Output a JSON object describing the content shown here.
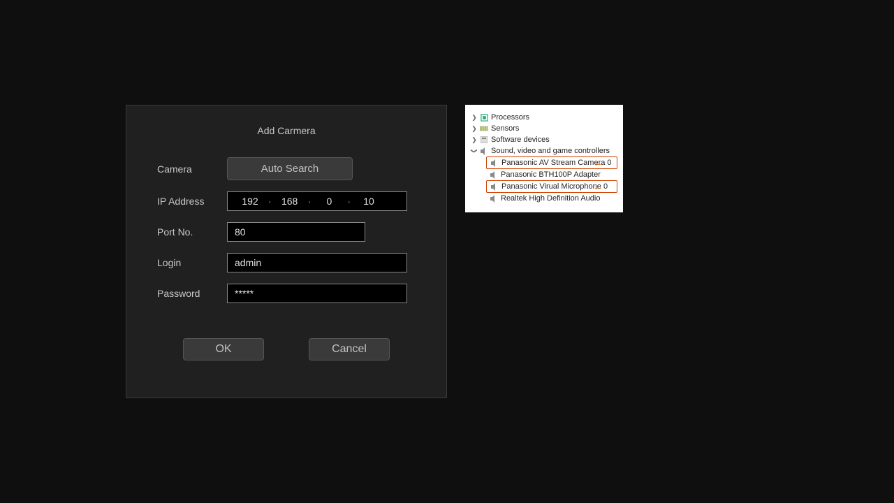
{
  "dialog": {
    "title": "Add Carmera",
    "labels": {
      "camera": "Camera",
      "ip": "IP  Address",
      "port": "Port No.",
      "login": "Login",
      "password": "Password"
    },
    "auto_search": "Auto Search",
    "ip_octets": [
      "192",
      "168",
      "0",
      "10"
    ],
    "port_value": "80",
    "login_value": "admin",
    "password_value": "*****",
    "ok": "OK",
    "cancel": "Cancel"
  },
  "device_tree": {
    "items": [
      {
        "label": "Processors",
        "expanded": false,
        "level": 0
      },
      {
        "label": "Sensors",
        "expanded": false,
        "level": 0
      },
      {
        "label": "Software devices",
        "expanded": false,
        "level": 0
      },
      {
        "label": "Sound, video and game controllers",
        "expanded": true,
        "level": 0
      }
    ],
    "children": [
      {
        "label": "Panasonic AV Stream Camera 0",
        "highlighted": true
      },
      {
        "label": "Panasonic BTH100P Adapter",
        "highlighted": false
      },
      {
        "label": "Panasonic Virual Microphone 0",
        "highlighted": true
      },
      {
        "label": "Realtek High Definition Audio",
        "highlighted": false
      }
    ]
  }
}
